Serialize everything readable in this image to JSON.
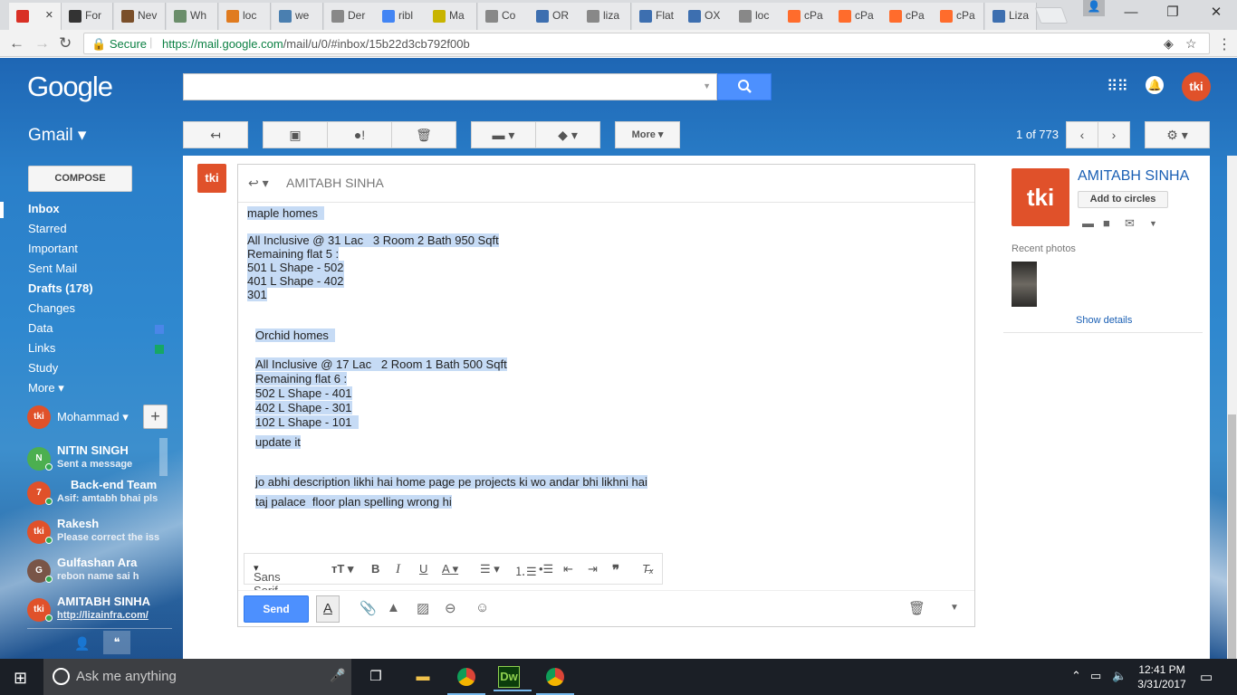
{
  "browser": {
    "tabs": [
      {
        "label": "M",
        "icon": "gmail-icon",
        "color": "#d93025",
        "active": true
      },
      {
        "label": "For",
        "icon": "page-icon",
        "color": "#333"
      },
      {
        "label": "Nev",
        "icon": "page-icon",
        "color": "#7a4f2a"
      },
      {
        "label": "Wh",
        "icon": "page-icon",
        "color": "#6b8e6b"
      },
      {
        "label": "loc",
        "icon": "page-icon",
        "color": "#e07b1f"
      },
      {
        "label": "we",
        "icon": "page-icon",
        "color": "#4a7fb0"
      },
      {
        "label": "Der",
        "icon": "page-icon",
        "color": "#888"
      },
      {
        "label": "ribl",
        "icon": "google-icon",
        "color": "#4285f4"
      },
      {
        "label": "Ma",
        "icon": "page-icon",
        "color": "#c8b400"
      },
      {
        "label": "Co",
        "icon": "page-icon",
        "color": "#888"
      },
      {
        "label": "OR",
        "icon": "page-icon",
        "color": "#3d6fb0"
      },
      {
        "label": "liza",
        "icon": "page-icon",
        "color": "#888"
      },
      {
        "label": "Flat",
        "icon": "page-icon",
        "color": "#3d6fb0"
      },
      {
        "label": "OX",
        "icon": "page-icon",
        "color": "#3d6fb0"
      },
      {
        "label": "loc",
        "icon": "page-icon",
        "color": "#888"
      },
      {
        "label": "cPa",
        "icon": "cpanel-icon",
        "color": "#ff6c2c"
      },
      {
        "label": "cPa",
        "icon": "cpanel-icon",
        "color": "#ff6c2c"
      },
      {
        "label": "cPa",
        "icon": "cpanel-icon",
        "color": "#ff6c2c"
      },
      {
        "label": "cPa",
        "icon": "cpanel-icon",
        "color": "#ff6c2c"
      },
      {
        "label": "Liza",
        "icon": "page-icon",
        "color": "#3d6fb0"
      }
    ],
    "secure_label": "Secure",
    "url_host": "https://mail.google.com",
    "url_path": "/mail/u/0/#inbox/15b22d3cb792f00b"
  },
  "gmail": {
    "logo": "Google",
    "app_label": "Gmail ▾",
    "toolbar_more": "More ▾",
    "pager": "1 of 773",
    "compose": "COMPOSE",
    "nav": [
      {
        "label": "Inbox",
        "bold": true,
        "active": true
      },
      {
        "label": "Starred"
      },
      {
        "label": "Important"
      },
      {
        "label": "Sent Mail"
      },
      {
        "label": "Drafts (178)",
        "bold": true
      },
      {
        "label": "Changes"
      },
      {
        "label": "Data",
        "color": "#4a86e8"
      },
      {
        "label": "Links",
        "color": "#16a765"
      },
      {
        "label": "Study"
      },
      {
        "label": "More ▾"
      }
    ],
    "me": {
      "name": "Mohammad",
      "avatar_text": "tki"
    },
    "contacts": [
      {
        "name": "NITIN SINGH",
        "status": "Sent a message",
        "avatar_text": "N",
        "avatar_color": "#4caf50"
      },
      {
        "name": "Back-end Team",
        "status": "Asif: amtabh bhai pls",
        "avatar_text": "7",
        "avatar_color": "#e0512a"
      },
      {
        "name": "Rakesh",
        "status": "Please correct the iss",
        "avatar_text": "tki",
        "avatar_color": "#e0512a"
      },
      {
        "name": "Gulfashan Ara",
        "status": "rebon name sai h",
        "avatar_text": "G",
        "avatar_color": "#795548"
      },
      {
        "name": "AMITABH SINHA",
        "status": "http://lizainfra.com/",
        "avatar_text": "tki",
        "avatar_color": "#e0512a"
      }
    ]
  },
  "message": {
    "sender_avatar": "tki",
    "to": "AMITABH SINHA",
    "lines": [
      {
        "text": "maple homes  ",
        "indent": false
      },
      {
        "text": "",
        "indent": false
      },
      {
        "text": "All Inclusive @ 31 Lac   3 Room 2 Bath 950 Sqft",
        "indent": false
      },
      {
        "text": "Remaining flat 5 :",
        "indent": false
      },
      {
        "text": "501 L Shape - 502",
        "indent": false
      },
      {
        "text": "401 L Shape - 402",
        "indent": false
      },
      {
        "text": "301",
        "indent": false
      },
      {
        "text": "",
        "indent": false
      },
      {
        "text": "",
        "indent": false
      },
      {
        "text": "Orchid homes  ",
        "indent": true
      },
      {
        "text": "",
        "indent": true
      },
      {
        "text": "All Inclusive @ 17 Lac   2 Room 1 Bath 500 Sqft",
        "indent": true
      },
      {
        "text": "Remaining flat 6 :",
        "indent": true
      },
      {
        "text": "502 L Shape - 401",
        "indent": true
      },
      {
        "text": "402 L Shape - 301",
        "indent": true
      },
      {
        "text": "102 L Shape - 101  ",
        "indent": true
      },
      {
        "text": "update it",
        "indent": true
      },
      {
        "text": "",
        "indent": true
      },
      {
        "text": "jo abhi description likhi hai home page pe projects ki wo andar bhi likhni hai",
        "indent": true
      },
      {
        "text": "taj palace  floor plan spelling wrong hi",
        "indent": true
      }
    ],
    "font_label": "Sans Serif",
    "send_label": "Send"
  },
  "contact_panel": {
    "name": "AMITABH SINHA",
    "avatar_text": "tki",
    "add_circles": "Add to circles",
    "recent_photos": "Recent photos",
    "show_details": "Show details"
  },
  "taskbar": {
    "search_placeholder": "Ask me anything",
    "time": "12:41 PM",
    "date": "3/31/2017"
  }
}
